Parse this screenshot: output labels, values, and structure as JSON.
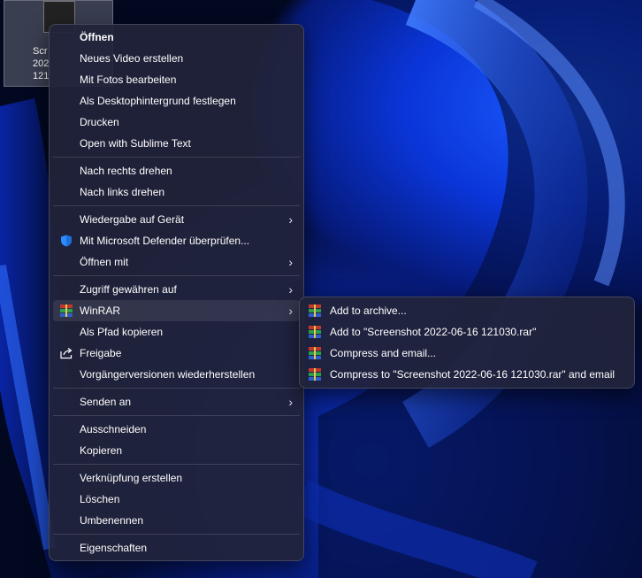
{
  "desktop_icon": {
    "lines": [
      "Scr",
      "202",
      "121"
    ]
  },
  "context_menu": {
    "items": [
      {
        "label": "Öffnen",
        "bold": true
      },
      {
        "label": "Neues Video erstellen"
      },
      {
        "label": "Mit Fotos bearbeiten"
      },
      {
        "label": "Als Desktophintergrund festlegen"
      },
      {
        "label": "Drucken"
      },
      {
        "label": "Open with Sublime Text"
      },
      {
        "label": "Nach rechts drehen"
      },
      {
        "label": "Nach links drehen"
      },
      {
        "label": "Wiedergabe auf Gerät"
      },
      {
        "label": "Mit Microsoft Defender überprüfen..."
      },
      {
        "label": "Öffnen mit"
      },
      {
        "label": "Zugriff gewähren auf"
      },
      {
        "label": "WinRAR"
      },
      {
        "label": "Als Pfad kopieren"
      },
      {
        "label": "Freigabe"
      },
      {
        "label": "Vorgängerversionen wiederherstellen"
      },
      {
        "label": "Senden an"
      },
      {
        "label": "Ausschneiden"
      },
      {
        "label": "Kopieren"
      },
      {
        "label": "Verknüpfung erstellen"
      },
      {
        "label": "Löschen"
      },
      {
        "label": "Umbenennen"
      },
      {
        "label": "Eigenschaften"
      }
    ]
  },
  "winrar_submenu": {
    "items": [
      {
        "label": "Add to archive..."
      },
      {
        "label": "Add to \"Screenshot 2022-06-16 121030.rar\""
      },
      {
        "label": "Compress and email..."
      },
      {
        "label": "Compress to \"Screenshot 2022-06-16 121030.rar\" and email"
      }
    ]
  },
  "icons": {
    "defender": "shield-icon",
    "share": "share-icon",
    "winrar": "winrar-icon",
    "submenu_arrow": "chevron-right-icon"
  },
  "colors": {
    "menu_bg": "#21243a",
    "highlight": "#3a3d52",
    "accent_blue": "#1c5cff"
  }
}
